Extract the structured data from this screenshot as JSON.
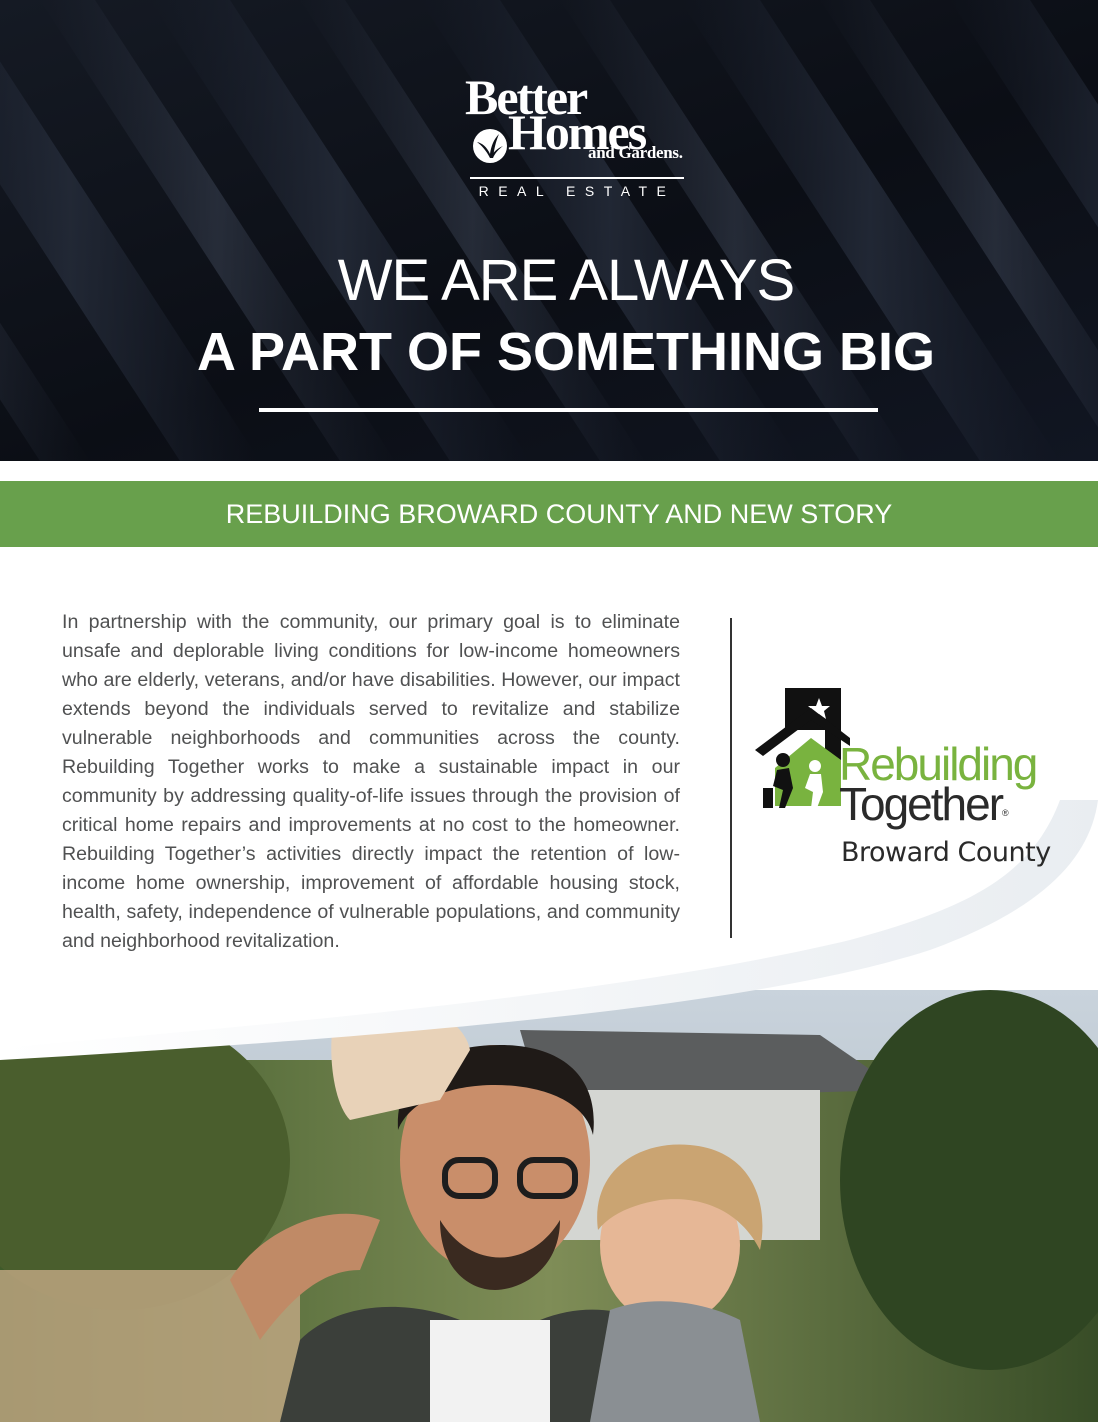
{
  "brand": {
    "line1": "Better",
    "line2": "Homes",
    "line3": "and Gardens.",
    "tagline": "REAL ESTATE"
  },
  "headline": {
    "line1": "WE ARE ALWAYS",
    "line2": "A PART OF SOMETHING BIG"
  },
  "banner": {
    "title": "REBUILDING BROWARD COUNTY AND NEW STORY"
  },
  "body": {
    "paragraph": "In partnership with the community, our primary goal is to eliminate unsafe and deplorable living conditions for low-income homeowners who are elderly, veterans, and/or have disabilities. However, our impact extends beyond the individuals served to revitalize and stabilize vulnerable neighborhoods and communities across the county. Rebuilding Together works to make a sustainable impact in our community by addressing quality-of-life issues through the provision of critical home repairs and improvements at no cost to the homeowner. Rebuilding Together’s activities directly impact the retention of low-income home ownership, improvement of affordable housing stock, health, safety, independence of vulnerable populations, and community and neighborhood revitalization."
  },
  "partner_logo": {
    "word1": "Rebuilding",
    "word2": "Together",
    "registered": "®",
    "location": "Broward County"
  },
  "colors": {
    "banner_green": "#68a04c",
    "logo_green": "#79b33f",
    "hero_dark": "#0b0e15",
    "body_text": "#505152"
  }
}
